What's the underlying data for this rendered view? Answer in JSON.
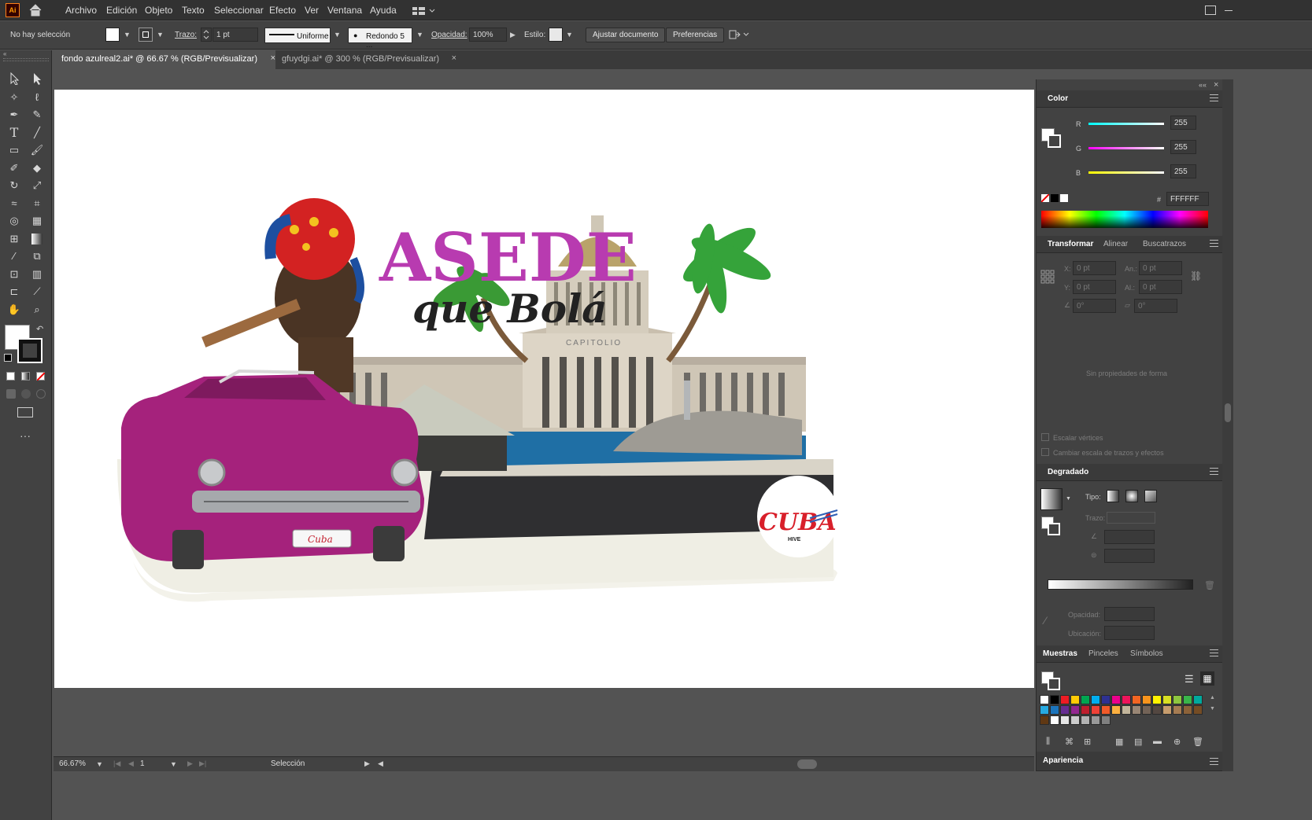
{
  "app": {
    "logo": "Ai",
    "home_icon": "home-icon"
  },
  "menu": [
    "Archivo",
    "Edición",
    "Objeto",
    "Texto",
    "Seleccionar",
    "Efecto",
    "Ver",
    "Ventana",
    "Ayuda"
  ],
  "control": {
    "selection": "No hay selección",
    "stroke_label": "Trazo:",
    "stroke_value": "1 pt",
    "profile": "Uniforme",
    "brush": "Redondo 5 ...",
    "opacity_label": "Opacidad:",
    "opacity_value": "100%",
    "style_label": "Estilo:",
    "fit_button": "Ajustar documento",
    "prefs_button": "Preferencias"
  },
  "tabs": [
    {
      "label": "fondo azulreal2.ai* @ 66.67 % (RGB/Previsualizar)",
      "active": true
    },
    {
      "label": "gfuydgi.ai* @ 300 % (RGB/Previsualizar)",
      "active": false
    }
  ],
  "artwork": {
    "title": "ASEDE",
    "script": "que Bolá",
    "building_label": "CAPITOLIO",
    "logo_text": "CUBA",
    "logo_sub": "HIVE",
    "plate_text": "Cuba"
  },
  "status": {
    "zoom": "66.67%",
    "page": "1",
    "tool": "Selección"
  },
  "color_panel": {
    "title": "Color",
    "r_label": "R",
    "g_label": "G",
    "b_label": "B",
    "r": "255",
    "g": "255",
    "b": "255",
    "hash": "#",
    "hex": "FFFFFF"
  },
  "transform_panel": {
    "tabs": [
      "Transformar",
      "Alinear",
      "Buscatrazos"
    ],
    "x_label": "X:",
    "x": "0 pt",
    "y_label": "Y:",
    "y": "0 pt",
    "w_label": "An.:",
    "w": "0 pt",
    "h_label": "Al.:",
    "h": "0 pt",
    "angle": "0°",
    "shear": "0°",
    "no_props": "Sin propiedades de forma",
    "scale_corners": "Escalar vértices",
    "scale_strokes": "Cambiar escala de trazos y efectos"
  },
  "gradient_panel": {
    "title": "Degradado",
    "type_label": "Tipo:",
    "stroke_label": "Trazo:",
    "opacity_label": "Opacidad:",
    "location_label": "Ubicación:"
  },
  "swatches_panel": {
    "tabs": [
      "Muestras",
      "Pinceles",
      "Símbolos"
    ],
    "colors": [
      "#ffffff",
      "#000000",
      "#ed1c24",
      "#ffcb05",
      "#00a651",
      "#00aeef",
      "#2e3192",
      "#ec008c",
      "#ed145b",
      "#f26522",
      "#f7941d",
      "#fff200",
      "#d7df23",
      "#8dc63f",
      "#39b54a",
      "#00a99d",
      "#27aae1",
      "#1c75bc",
      "#662d91",
      "#92278f",
      "#be1e2d",
      "#ef4136",
      "#f15a29",
      "#fbb040",
      "#c2b59b",
      "#998675",
      "#736357",
      "#534741",
      "#c69c6d",
      "#a67c52",
      "#8c6239",
      "#754c24",
      "#603813",
      "#ffffff",
      "#e6e6e6",
      "#cccccc",
      "#b3b3b3",
      "#999999",
      "#808080"
    ]
  },
  "appearance_panel": {
    "title": "Apariencia"
  }
}
